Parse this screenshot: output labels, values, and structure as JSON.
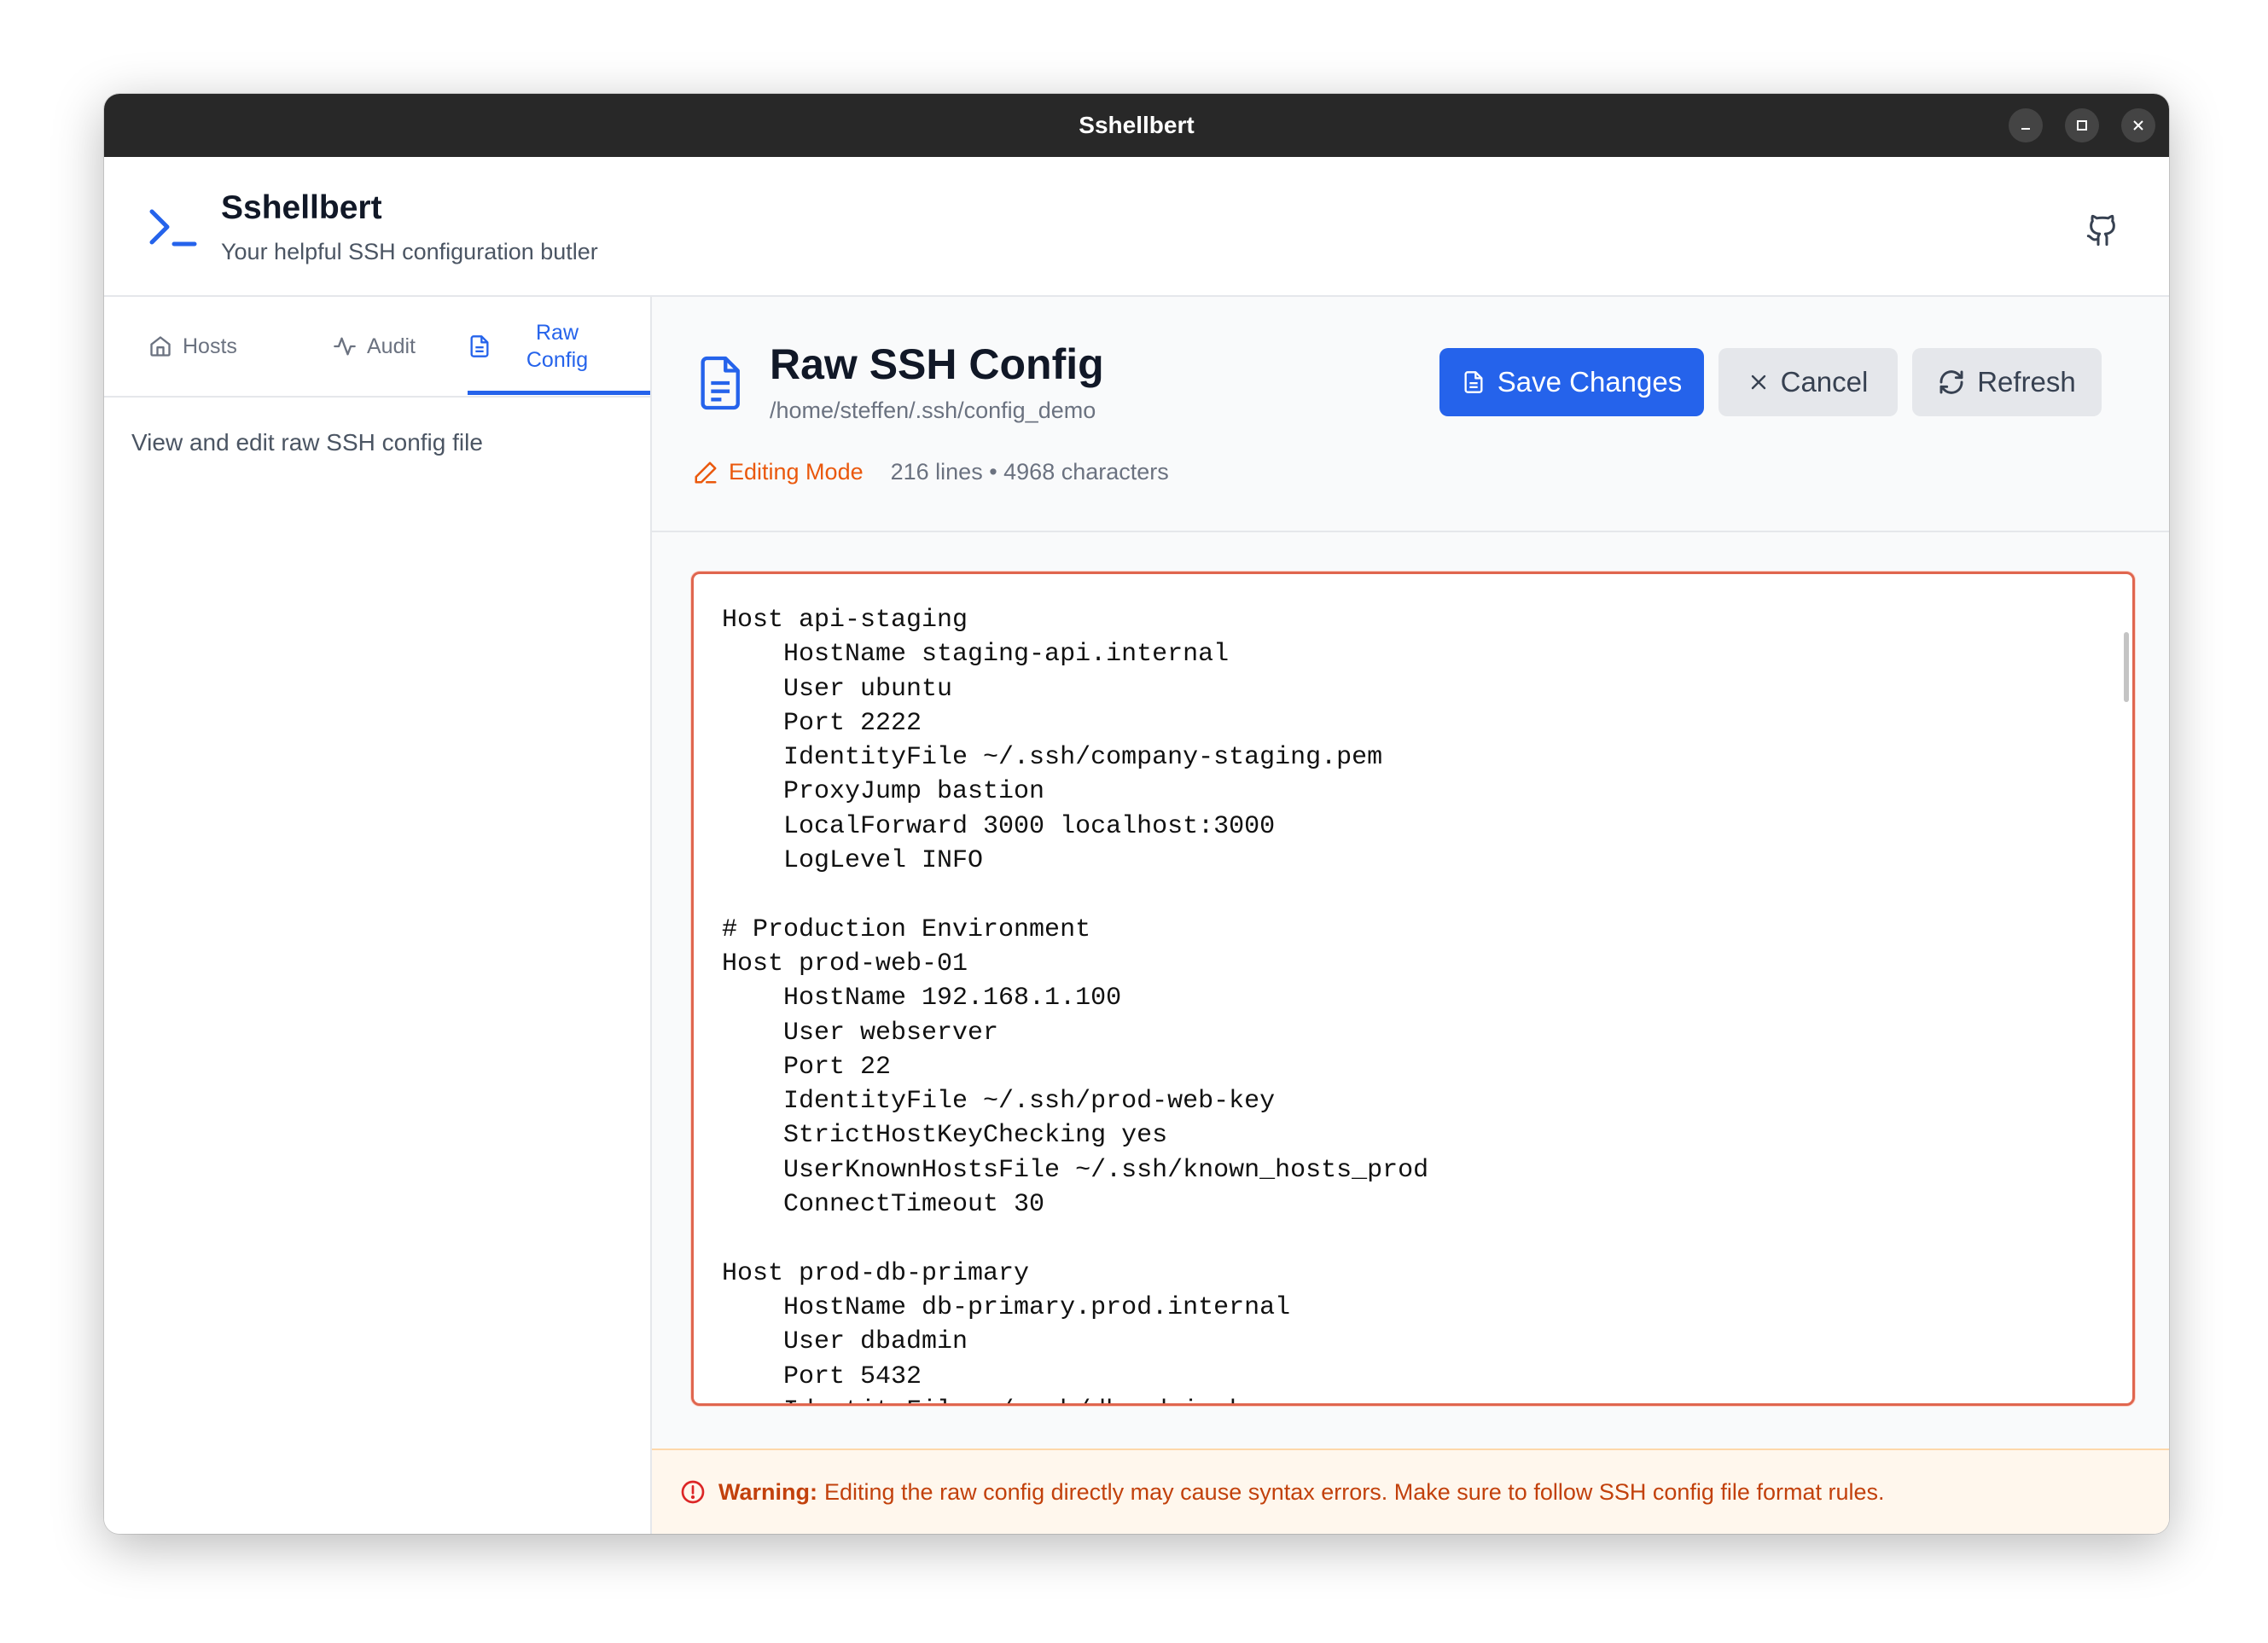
{
  "window": {
    "title": "Sshellbert"
  },
  "header": {
    "app_name": "Sshellbert",
    "tagline": "Your helpful SSH configuration butler"
  },
  "sidebar": {
    "tabs": [
      {
        "label": "Hosts",
        "icon": "home-icon"
      },
      {
        "label": "Audit",
        "icon": "activity-icon"
      },
      {
        "label": "Raw Config",
        "icon": "file-text-icon",
        "active": true
      }
    ],
    "description": "View and edit raw SSH config file"
  },
  "main": {
    "title": "Raw SSH Config",
    "path": "/home/steffen/.ssh/config_demo",
    "buttons": {
      "save": "Save Changes",
      "cancel": "Cancel",
      "refresh": "Refresh"
    },
    "mode": "Editing Mode",
    "stats": "216 lines • 4968 characters",
    "editor_content": "Host api-staging\n    HostName staging-api.internal\n    User ubuntu\n    Port 2222\n    IdentityFile ~/.ssh/company-staging.pem\n    ProxyJump bastion\n    LocalForward 3000 localhost:3000\n    LogLevel INFO\n\n# Production Environment\nHost prod-web-01\n    HostName 192.168.1.100\n    User webserver\n    Port 22\n    IdentityFile ~/.ssh/prod-web-key\n    StrictHostKeyChecking yes\n    UserKnownHostsFile ~/.ssh/known_hosts_prod\n    ConnectTimeout 30\n\nHost prod-db-primary\n    HostName db-primary.prod.internal\n    User dbadmin\n    Port 5432\n    IdentityFile ~/.ssh/db-admin-key",
    "warning_label": "Warning:",
    "warning_text": "Editing the raw config directly may cause syntax errors. Make sure to follow SSH config file format rules."
  },
  "colors": {
    "accent": "#2563eb",
    "editing": "#ea580c",
    "editor_border": "#e0664f",
    "warning_bg": "#fff7ed",
    "titlebar": "#282828"
  }
}
